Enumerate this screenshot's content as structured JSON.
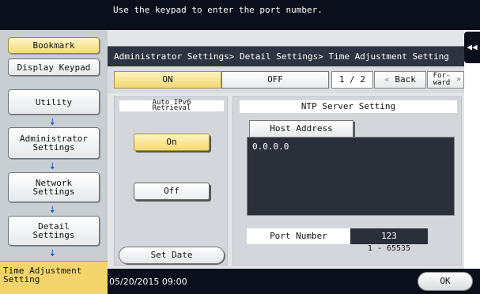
{
  "message": "Use the keypad to enter the port number.",
  "left_panel": {
    "bookmark": "Bookmark",
    "display_keypad": "Display Keypad",
    "utility": "Utility",
    "admin_line1": "Administrator",
    "admin_line2": "Settings",
    "network_line1": "Network",
    "network_line2": "Settings",
    "detail_line1": "Detail",
    "detail_line2": "Settings",
    "current_line1": "Time Adjustment",
    "current_line2": "Setting"
  },
  "window": {
    "title": "Administrator Settings> Detail Settings> Time Adjustment Setting",
    "tab_on": "ON",
    "tab_off": "OFF",
    "page_indicator": "1 / 2",
    "back_label": "Back",
    "forward_line1": "For-",
    "forward_line2": "ward"
  },
  "auto_ipv6": {
    "label_line1": "Auto IPv6",
    "label_line2": "Retrieval",
    "on_label": "On",
    "off_label": "Off",
    "selected": "On"
  },
  "set_date_label": "Set Date",
  "ntp": {
    "title": "NTP Server Setting",
    "host_button": "Host Address",
    "host_value": "0.0.0.0",
    "port_label": "Port Number",
    "port_value": "123",
    "port_range": "1 - 65535"
  },
  "bottom": {
    "datetime": "05/20/2015  09:00",
    "ok_label": "OK"
  },
  "colors": {
    "accent_yellow": "#f3d973",
    "dark_bar": "#0b0f1c",
    "arrow_blue": "#1f5fc7"
  }
}
